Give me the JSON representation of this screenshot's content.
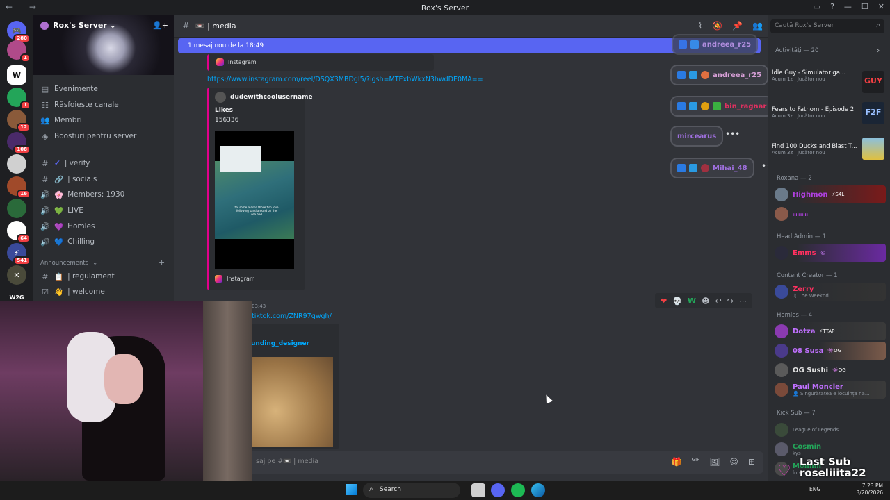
{
  "window": {
    "title": "Rox's Server",
    "nav": "← →",
    "controls": [
      "▭",
      "?",
      "—",
      "☐",
      "✕"
    ]
  },
  "guilds": [
    {
      "badge": "280",
      "color": "#5865f2",
      "label": "🎮"
    },
    {
      "badge": "1",
      "color": "#b04a8a",
      "label": ""
    },
    {
      "badge": "",
      "color": "#ffffff",
      "label": "W"
    },
    {
      "badge": "1",
      "color": "#23a559",
      "label": ""
    },
    {
      "badge": "12",
      "color": "#8a5a3a",
      "label": ""
    },
    {
      "badge": "108",
      "color": "#4a2a6a",
      "label": ""
    },
    {
      "badge": "",
      "color": "#d0d0d0",
      "label": ""
    },
    {
      "badge": "16",
      "color": "#a04a2a",
      "label": ""
    },
    {
      "badge": "",
      "color": "#2a6a3a",
      "label": ""
    },
    {
      "badge": "64",
      "color": "#ffffff",
      "label": ""
    },
    {
      "badge": "541",
      "color": "#3a4a9a",
      "label": "⚡"
    },
    {
      "badge": "",
      "color": "#4a4a3a",
      "label": "✕"
    },
    {
      "badge": "",
      "color": "#1e1f22",
      "label": "W2G"
    }
  ],
  "server": {
    "name": "Rox's Server",
    "chevron": "⌄"
  },
  "sidebar_items": [
    {
      "icon": "▤",
      "label": "Evenimente"
    },
    {
      "icon": "☷",
      "label": "Răsfoiește canale"
    },
    {
      "icon": "👥",
      "label": "Membri"
    },
    {
      "icon": "◈",
      "label": "Boosturi pentru server"
    }
  ],
  "channels": [
    {
      "icon": "#",
      "emoji": "✔",
      "label": "| verify"
    },
    {
      "icon": "#",
      "emoji": "🔗",
      "label": "| socials"
    },
    {
      "icon": "🔊",
      "emoji": "🌸",
      "label": "Members: 1930"
    },
    {
      "icon": "🔊",
      "emoji": "💚",
      "label": "LIVE"
    },
    {
      "icon": "🔊",
      "emoji": "💜",
      "label": "Homies"
    },
    {
      "icon": "🔊",
      "emoji": "💙",
      "label": "Chilling"
    }
  ],
  "category": {
    "name": "Announcements",
    "add": "+"
  },
  "category_channels": [
    {
      "icon": "#",
      "emoji": "📋",
      "label": "| regulament"
    },
    {
      "icon": "☑",
      "emoji": "👋",
      "label": "| welcome"
    }
  ],
  "channel": {
    "name": "| media",
    "hash": "#",
    "icon": "📼"
  },
  "new_messages": "1 mesaj nou de la 18:49",
  "messages": {
    "instagram1": "Instagram",
    "link": "https://www.instagram.com/reel/DSQX3MBDgI5/?igsh=MTExbWkxN3hwdDE0MA==",
    "author": "dudewithcoolusername",
    "likes_label": "Likes",
    "likes": "156336",
    "video_caption": "for some reason those fish love following sand around on the sea bed",
    "instagram2": "Instagram",
    "time": "03:43",
    "tiktok": "tiktok.com/ZNR97qwgh/",
    "tt_author": "unding_designer"
  },
  "reactions": [
    "❤",
    "💀",
    "W",
    "☻",
    "↩",
    "↪",
    "⋯"
  ],
  "composer": {
    "placeholder": "saj pe #📼 | media"
  },
  "composer_icons": [
    "🎁",
    "GIF",
    "🖼",
    "☺",
    "⊞"
  ],
  "header_icons": [
    "⌇",
    "🔕",
    "📌",
    "👥"
  ],
  "search_placeholder": "Caută Rox's Server",
  "voice_overlay": [
    {
      "name": "andreea_r25",
      "color": "#d8a0d8"
    },
    {
      "name": "andreea_r25",
      "color": "#d8a0d8"
    },
    {
      "name": "bin_ragnar",
      "color": "#e03060"
    },
    {
      "name": "mircearus",
      "color": "#a070e0"
    },
    {
      "name": "Mihai_48",
      "color": "#a070e0"
    }
  ],
  "activity": {
    "label": "Activități — 20",
    "arrow": "›"
  },
  "activity_cards": [
    {
      "title": "Idle Guy - Simulator ga...",
      "time": "Acum 1z",
      "note": "Jucător nou",
      "thumb": "GUY"
    },
    {
      "title": "Fears to Fathom - Episode 2",
      "time": "Acum 3z",
      "note": "Jucător nou",
      "thumb": "F2F"
    },
    {
      "title": "Find 100 Ducks and Blast T...",
      "time": "Acum 3z",
      "note": "Jucător nou",
      "thumb": ""
    }
  ],
  "member_groups": [
    {
      "label": "Roxana — 2",
      "members": [
        {
          "name": "Highmon",
          "tag": "⚡S4L",
          "color": "#b040e0",
          "status": ""
        },
        {
          "name": "ᵢᵢᵢᵢᵢᵢᵢᵢᵢᵢ",
          "tag": "",
          "color": "#b040e0",
          "status": ""
        }
      ]
    },
    {
      "label": "Head Admin — 1",
      "members": [
        {
          "name": "Emms",
          "tag": "©",
          "color": "#ff3060",
          "status": ""
        }
      ]
    },
    {
      "label": "Content Creator — 1",
      "members": [
        {
          "name": "Zerry",
          "tag": "",
          "color": "#ff3060",
          "status": "♫ The Weeknd"
        }
      ]
    },
    {
      "label": "Homies — 4",
      "members": [
        {
          "name": "Dotza",
          "tag": "⚡TTAP",
          "color": "#c070ff",
          "status": ""
        },
        {
          "name": "08 Susa",
          "tag": "👾OG",
          "color": "#c070ff",
          "status": ""
        },
        {
          "name": "OG Sushi",
          "tag": "👾OG",
          "color": "#e0e0e0",
          "status": ""
        },
        {
          "name": "Paul Moncler",
          "tag": "",
          "color": "#c070ff",
          "status": "👤 Singurătatea e locuința na..."
        }
      ]
    },
    {
      "label": "Kick Sub — 7",
      "members": [
        {
          "name": "",
          "tag": "",
          "color": "#23a559",
          "status": "League of Legends"
        },
        {
          "name": "Cosmin",
          "tag": "",
          "color": "#23a559",
          "status": "kys"
        },
        {
          "name": "Mommi",
          "tag": "",
          "color": "#23a559",
          "status": "în voce"
        }
      ]
    }
  ],
  "overlay": {
    "last_sub": "Last Sub",
    "username": "roseliiita22"
  },
  "taskbar": {
    "search": "Search",
    "lang": "ENG",
    "time": "7:23 PM",
    "date": "3/20/2026"
  }
}
